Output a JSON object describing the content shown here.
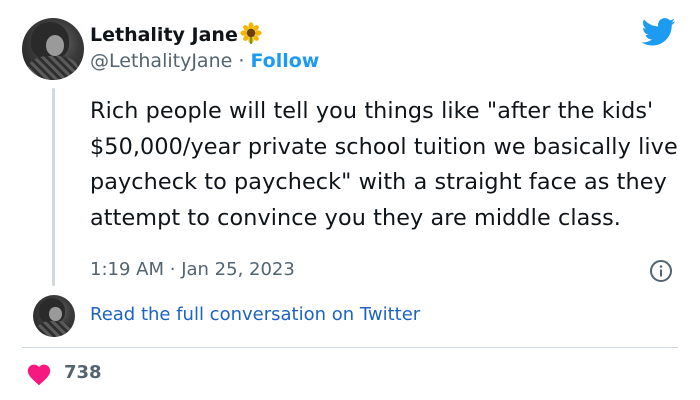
{
  "author": {
    "display_name": "Lethality Jane",
    "emoji_icon": "sunflower-icon",
    "handle": "@LethalityJane",
    "separator": "·",
    "follow_label": "Follow"
  },
  "tweet": {
    "text": "Rich people will tell you things like \"after the kids' $50,000/year private school tuition we basically live paycheck to paycheck\" with a straight face as they attempt to convince you they are middle class.",
    "time": "1:19 AM",
    "separator": "·",
    "date": "Jan 25, 2023"
  },
  "conversation_link": "Read the full conversation on Twitter",
  "likes": {
    "count": "738"
  },
  "icons": {
    "brand": "twitter-bird-icon",
    "info": "info-icon",
    "like": "heart-icon"
  },
  "colors": {
    "brand_blue": "#1d9bf0",
    "link_blue": "#1d63c4",
    "heart_pink": "#f91880",
    "muted_text": "#536471",
    "primary_text": "#0f1419",
    "divider": "#cfd9de"
  }
}
